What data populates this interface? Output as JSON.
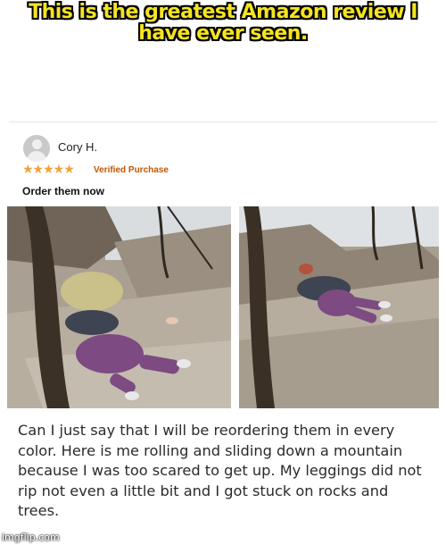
{
  "meme": {
    "caption_line1": "This is the greatest Amazon review I",
    "caption_line2": "have ever seen."
  },
  "review": {
    "reviewer_name": "Cory H.",
    "stars": "★★★★★",
    "rating": 5,
    "verified_label": "Verified Purchase",
    "title": "Order them now",
    "body": "Can I just say that I will be reordering them in every color. Here is me rolling and sliding down a mountain because I was too scared to get up. My leggings did not rip not even a little bit and I got stuck on rocks and trees."
  },
  "watermark": "imgflip.com",
  "colors": {
    "caption_fill": "#f5e41f",
    "star_color": "#f2a23a",
    "verified_color": "#c45500"
  }
}
